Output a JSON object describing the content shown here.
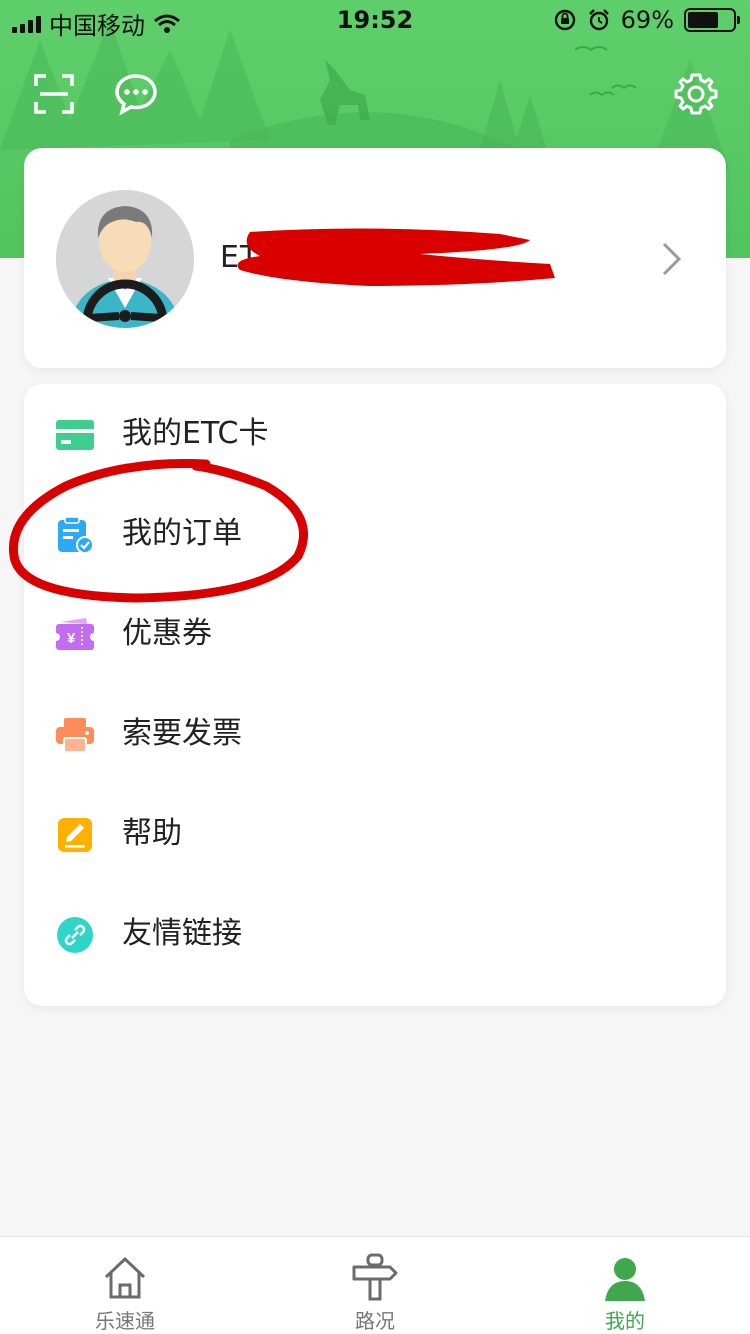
{
  "status_bar": {
    "carrier": "中国移动",
    "time": "19:52",
    "battery": "69%",
    "battery_level": 0.69
  },
  "header": {
    "scan_icon": "scan-icon",
    "message_icon": "message-icon",
    "settings_icon": "gear-icon"
  },
  "profile": {
    "name_visible": "ET",
    "avatar_icon": "driver-avatar",
    "arrow_icon": "chevron-right-icon"
  },
  "menu": {
    "items": [
      {
        "label": "我的ETC卡",
        "icon": "etc-card-icon",
        "color": "#3ecf8e"
      },
      {
        "label": "我的订单",
        "icon": "order-icon",
        "color": "#2da9f5"
      },
      {
        "label": "优惠券",
        "icon": "coupon-icon",
        "color": "#c36cf0"
      },
      {
        "label": "索要发票",
        "icon": "printer-icon",
        "color": "#ff8c5a"
      },
      {
        "label": "帮助",
        "icon": "edit-icon",
        "color": "#ffb000"
      },
      {
        "label": "友情链接",
        "icon": "link-icon",
        "color": "#2fd6c8"
      }
    ]
  },
  "tabbar": {
    "tabs": [
      {
        "label": "乐速通",
        "icon": "home-icon",
        "active": false
      },
      {
        "label": "路况",
        "icon": "signpost-icon",
        "active": false
      },
      {
        "label": "我的",
        "icon": "person-icon",
        "active": true
      }
    ]
  },
  "colors": {
    "brand_green": "#52c45f",
    "active_tab": "#3fa84c",
    "annotation_red": "#d90000"
  }
}
